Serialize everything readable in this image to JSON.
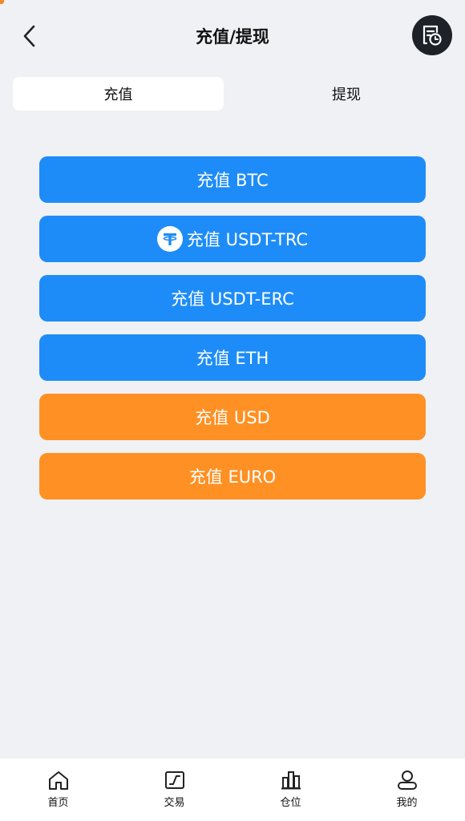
{
  "header": {
    "title": "充值/提现",
    "back_icon": "chevron-left-icon",
    "history_icon": "record-history-icon"
  },
  "tabs": [
    {
      "label": "充值",
      "active": true
    },
    {
      "label": "提现",
      "active": false
    }
  ],
  "actions": [
    {
      "label": "充值 BTC",
      "color": "#1e8cf8"
    },
    {
      "label": "充值 USDT-TRC",
      "color": "#1e8cf8",
      "icon": "tether-icon"
    },
    {
      "label": "充值 USDT-ERC",
      "color": "#1e8cf8"
    },
    {
      "label": "充值 ETH",
      "color": "#1e8cf8"
    },
    {
      "label": "充值 USD",
      "color": "#ff9023"
    },
    {
      "label": "充值 EURO",
      "color": "#ff9023"
    }
  ],
  "bottom_nav": [
    {
      "label": "首页",
      "icon": "home-icon"
    },
    {
      "label": "交易",
      "icon": "trade-chart-icon"
    },
    {
      "label": "仓位",
      "icon": "position-bars-icon"
    },
    {
      "label": "我的",
      "icon": "user-icon"
    }
  ],
  "colors": {
    "background": "#eff1f5",
    "primary_blue": "#1e8cf8",
    "accent_orange": "#ff9023"
  }
}
